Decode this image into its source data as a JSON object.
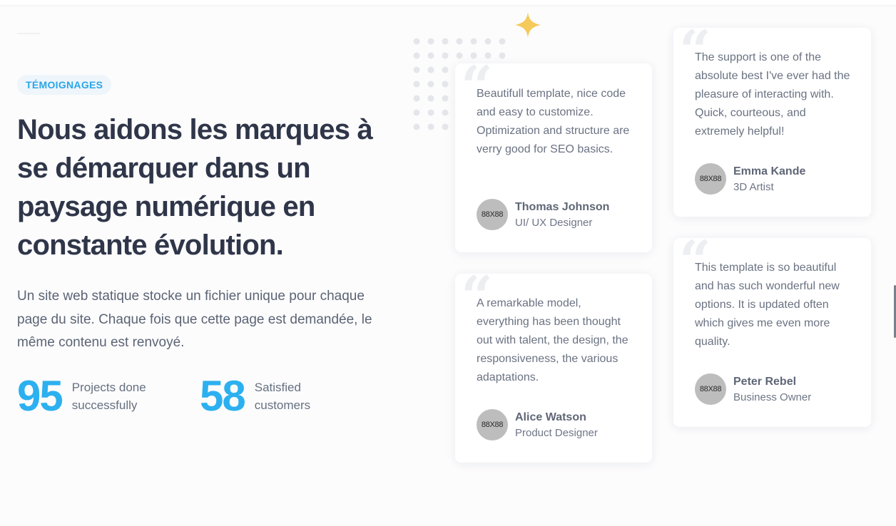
{
  "section": {
    "badge": "TÉMOIGNAGES",
    "headline": "Nous aidons les marques à se démarquer dans un paysage numérique en constante évolution.",
    "description": "Un site web statique stocke un fichier unique pour chaque page du site. Chaque fois que cette page est demandée, le même contenu est renvoyé."
  },
  "stats": [
    {
      "number": "95",
      "label": "Projects done successfully"
    },
    {
      "number": "58",
      "label": "Satisfied customers"
    }
  ],
  "testimonials": [
    {
      "quote_mark": "“",
      "text": "Beautifull template, nice code and easy to customize. Optimization and structure are verry good for SEO basics.",
      "avatar": "88X88",
      "name": "Thomas Johnson",
      "role": "UI/ UX Designer"
    },
    {
      "quote_mark": "“",
      "text": "The support is one of the absolute best I've ever had the pleasure of interacting with. Quick, courteous, and extremely helpful!",
      "avatar": "88X88",
      "name": "Emma Kande",
      "role": "3D Artist"
    },
    {
      "quote_mark": "“",
      "text": "A remarkable model, everything has been thought out with talent, the design, the responsiveness, the various adaptations.",
      "avatar": "88X88",
      "name": "Alice Watson",
      "role": "Product Designer"
    },
    {
      "quote_mark": "“",
      "text": "This template is so beautiful and has such wonderful new options. It is updated often which gives me even more quality.",
      "avatar": "88X88",
      "name": "Peter Rebel",
      "role": "Business Owner"
    }
  ],
  "colors": {
    "accent": "#2cb0ef",
    "heading": "#2f3649",
    "sparkle": "#f5c95a",
    "dots": "#e4e6ea"
  },
  "icons": {
    "sparkle": "sparkle-icon",
    "quote": "quote-icon"
  }
}
